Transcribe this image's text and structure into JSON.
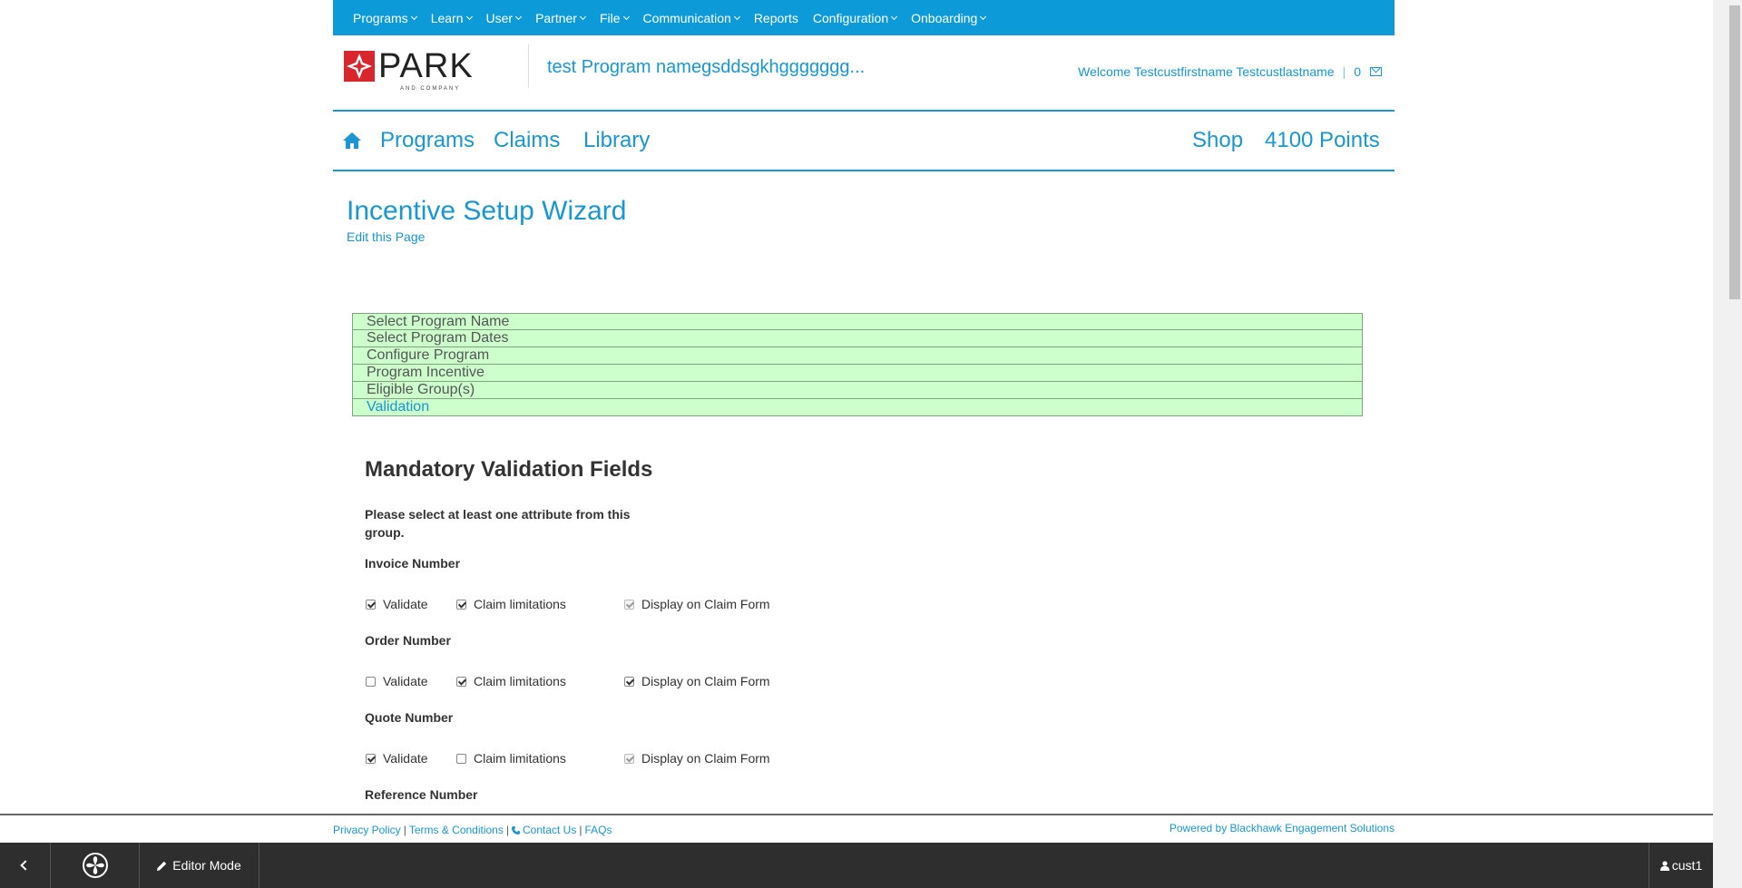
{
  "topnav": {
    "items": [
      {
        "label": "Programs",
        "dropdown": true
      },
      {
        "label": "Learn",
        "dropdown": true
      },
      {
        "label": "User",
        "dropdown": true
      },
      {
        "label": "Partner",
        "dropdown": true
      },
      {
        "label": "File",
        "dropdown": true
      },
      {
        "label": "Communication",
        "dropdown": true
      },
      {
        "label": "Reports",
        "dropdown": false
      },
      {
        "label": "Configuration",
        "dropdown": true
      },
      {
        "label": "Onboarding",
        "dropdown": true
      }
    ],
    "color": "#0d9ad8"
  },
  "header": {
    "logo_text": "PARK",
    "logo_sub": "AND COMPANY",
    "program_name": "test Program namegsddsgkhggggggg...",
    "welcome": "Welcome Testcustfirstname Testcustlastname",
    "separator": "|",
    "message_count": "0"
  },
  "mainnav": {
    "home_icon": "home-icon",
    "programs": "Programs",
    "claims": "Claims",
    "library": "Library",
    "shop": "Shop",
    "points": "4100 Points"
  },
  "content": {
    "title": "Incentive Setup Wizard",
    "edit_link": "Edit this Page",
    "steps": [
      {
        "label": "Select Program Name",
        "active": false
      },
      {
        "label": "Select Program Dates",
        "active": false
      },
      {
        "label": "Configure Program",
        "active": false
      },
      {
        "label": "Program Incentive",
        "active": false
      },
      {
        "label": "Eligible Group(s)",
        "active": false
      },
      {
        "label": "Validation",
        "active": true
      }
    ],
    "section_title": "Mandatory Validation Fields",
    "instruction": "Please select at least one attribute from this group.",
    "fields": [
      {
        "label": "Invoice Number",
        "validate": {
          "label": "Validate",
          "checked": true
        },
        "claim_limitations": {
          "label": "Claim limitations",
          "checked": true
        },
        "display": {
          "label": "Display on Claim Form",
          "checked": true,
          "disabled": true
        }
      },
      {
        "label": "Order Number",
        "validate": {
          "label": "Validate",
          "checked": false
        },
        "claim_limitations": {
          "label": "Claim limitations",
          "checked": true
        },
        "display": {
          "label": "Display on Claim Form",
          "checked": true,
          "disabled": false
        }
      },
      {
        "label": "Quote Number",
        "validate": {
          "label": "Validate",
          "checked": true
        },
        "claim_limitations": {
          "label": "Claim limitations",
          "checked": false
        },
        "display": {
          "label": "Display on Claim Form",
          "checked": true,
          "disabled": true
        }
      },
      {
        "label": "Reference Number"
      }
    ]
  },
  "footer": {
    "privacy": "Privacy Policy",
    "terms": "Terms & Conditions",
    "contact": "Contact Us",
    "faqs": "FAQs",
    "sep": "|",
    "powered": "Powered by Blackhawk Engagement Solutions"
  },
  "toolbar": {
    "editor_mode": "Editor Mode",
    "user": "cust1"
  }
}
